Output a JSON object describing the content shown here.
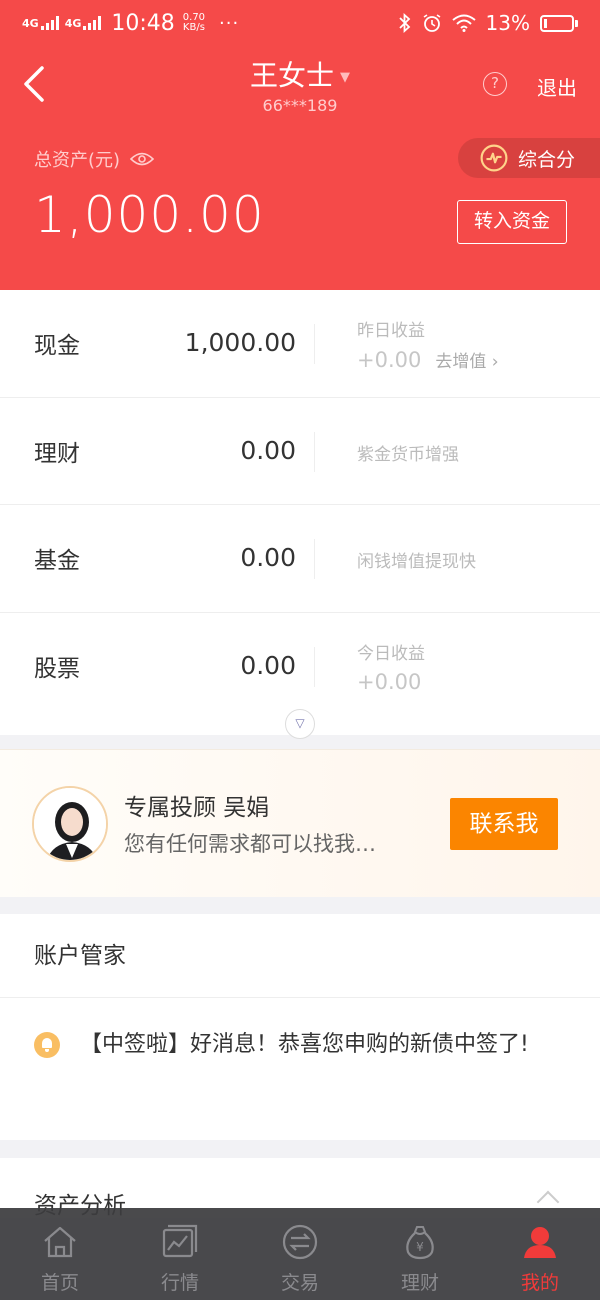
{
  "status_bar": {
    "signal1": "4G",
    "signal2": "4G",
    "time": "10:48",
    "speed_value": "0.70",
    "speed_unit": "KB/s",
    "more": "···",
    "battery": "13%",
    "battery_level": 0.13
  },
  "header": {
    "user_name": "王女士",
    "user_id": "66***189",
    "help": "?",
    "logout": "退出",
    "assets_label": "总资产(元)",
    "total_assets": "1,000.00",
    "score_label": "综合分",
    "transfer_label": "转入资金"
  },
  "holdings": [
    {
      "name": "现金",
      "amount": "1,000.00",
      "side_label": "昨日收益",
      "side_value": "+0.00",
      "side_link": "去增值 ›"
    },
    {
      "name": "理财",
      "amount": "0.00",
      "side_tip": "紫金货币增强"
    },
    {
      "name": "基金",
      "amount": "0.00",
      "side_tip": "闲钱增值提现快"
    },
    {
      "name": "股票",
      "amount": "0.00",
      "side_label": "今日收益",
      "side_value": "+0.00"
    }
  ],
  "advisor": {
    "title": "专属投顾 吴娟",
    "subtitle": "您有任何需求都可以找我…",
    "contact_label": "联系我"
  },
  "account_manager": {
    "title": "账户管家",
    "notice": "【中签啦】好消息！恭喜您申购的新债中签了!"
  },
  "analysis": {
    "title": "资产分析"
  },
  "tabs": [
    {
      "label": "首页",
      "icon": "home-icon",
      "active": false
    },
    {
      "label": "行情",
      "icon": "market-chart-icon",
      "active": false
    },
    {
      "label": "交易",
      "icon": "exchange-icon",
      "active": false
    },
    {
      "label": "理财",
      "icon": "money-bag-icon",
      "active": false
    },
    {
      "label": "我的",
      "icon": "user-icon",
      "active": true
    }
  ],
  "colors": {
    "brand_red": "#f54a49",
    "contact_orange": "#fb8500",
    "active_tab": "#f03b3a"
  }
}
